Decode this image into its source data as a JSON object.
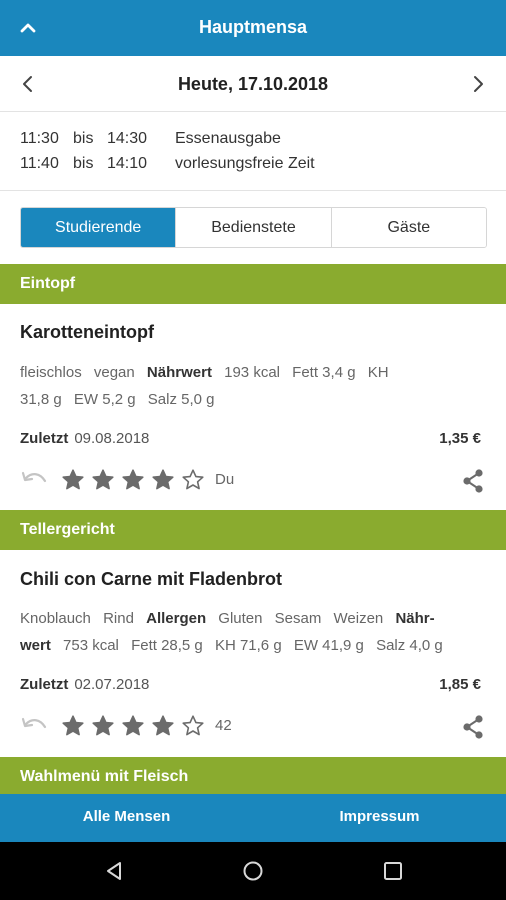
{
  "header": {
    "title": "Hauptmensa",
    "up_icon": "chevron-up-icon"
  },
  "date_nav": {
    "date": "Heute, 17.10.2018",
    "prev_icon": "chevron-left-icon",
    "next_icon": "chevron-right-icon"
  },
  "hours": [
    {
      "from": "11:30",
      "sep": "bis",
      "to": "14:30",
      "label": "Essenausgabe"
    },
    {
      "from": "11:40",
      "sep": "bis",
      "to": "14:10",
      "label": "vorlesungsfreie Zeit"
    }
  ],
  "price_tabs": [
    {
      "label": "Studierende",
      "active": true
    },
    {
      "label": "Bedienstete",
      "active": false
    },
    {
      "label": "Gäste",
      "active": false
    }
  ],
  "sections": [
    {
      "title": "Eintopf",
      "dish": {
        "name": "Karotteneintopf",
        "info_line1": [
          "fleischlos",
          "vegan"
        ],
        "nutrition_label": "Nährwert",
        "nutrition_line1": [
          "193 kcal",
          "Fett 3,4 g",
          "KH"
        ],
        "nutrition_line2": [
          "31,8 g",
          "EW 5,2 g",
          "Salz 5,0 g"
        ],
        "last_label": "Zuletzt",
        "last_date": "09.08.2018",
        "price": "1,35 €",
        "rating": 4,
        "rating_max": 5,
        "rating_note": "Du"
      }
    },
    {
      "title": "Tellergericht",
      "dish": {
        "name": "Chili con Carne mit Fladenbrot",
        "info_line1": [
          "Knoblauch",
          "Rind"
        ],
        "allergen_label": "Allergen",
        "allergens": [
          "Gluten",
          "Sesam",
          "Weizen"
        ],
        "nutrition_label_1": "Nähr-",
        "nutrition_label_2": "wert",
        "nutrition_line2": [
          "753 kcal",
          "Fett 28,5 g",
          "KH 71,6 g",
          "EW 41,9 g",
          "Salz 4,0 g"
        ],
        "last_label": "Zuletzt",
        "last_date": "02.07.2018",
        "price": "1,85 €",
        "rating": 4,
        "rating_max": 5,
        "rating_note": "42"
      }
    },
    {
      "title": "Wahlmenü mit Fleisch"
    }
  ],
  "bottom_nav": {
    "all": "Alle Mensen",
    "imprint": "Impressum"
  },
  "colors": {
    "primary": "#1a87bd",
    "section": "#8aab2f",
    "star": "#6b6b6b"
  }
}
